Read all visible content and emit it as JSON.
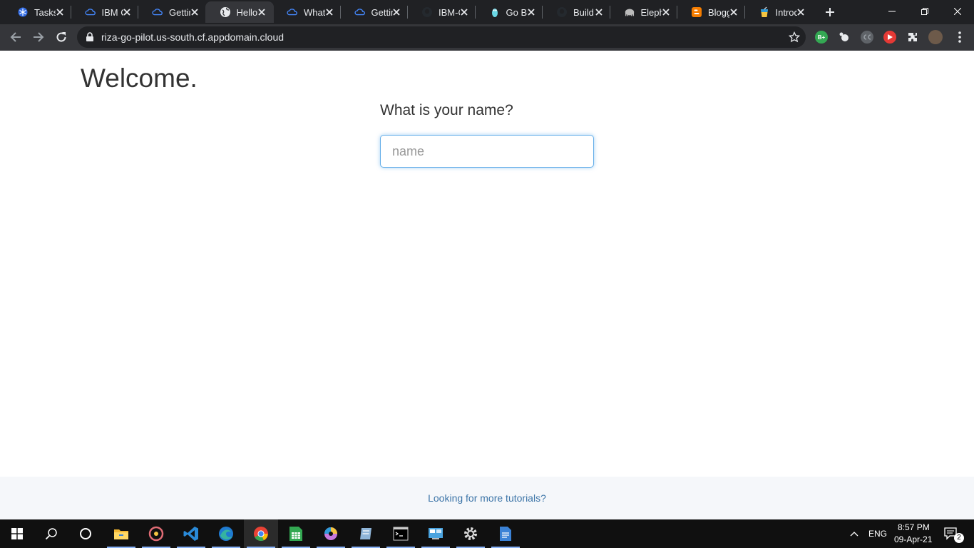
{
  "browser": {
    "tabs": [
      {
        "title": "Tasks",
        "icon": "kubernetes-icon",
        "active": false
      },
      {
        "title": "IBM C",
        "icon": "ibm-cloud-icon",
        "active": false
      },
      {
        "title": "Gettin",
        "icon": "ibm-cloud-icon",
        "active": false
      },
      {
        "title": "Hello",
        "icon": "globe-icon",
        "active": true
      },
      {
        "title": "What",
        "icon": "ibm-cloud-icon",
        "active": false
      },
      {
        "title": "Gettin",
        "icon": "ibm-cloud-icon",
        "active": false
      },
      {
        "title": "IBM-C",
        "icon": "github-icon",
        "active": false
      },
      {
        "title": "Go Bu",
        "icon": "gopher-icon",
        "active": false
      },
      {
        "title": "Build",
        "icon": "github-icon",
        "active": false
      },
      {
        "title": "Eleph",
        "icon": "elephant-icon",
        "active": false
      },
      {
        "title": "Blogg",
        "icon": "blogger-icon",
        "active": false
      },
      {
        "title": "Introd",
        "icon": "drink-icon",
        "active": false
      }
    ],
    "url": "riza-go-pilot.us-south.cf.appdomain.cloud",
    "extensions": [
      {
        "name": "bplus-extension-icon",
        "label": "B+",
        "color": "#34a853"
      },
      {
        "name": "bubbles-extension-icon",
        "label": "",
        "color": "#35363a"
      },
      {
        "name": "cc-extension-icon",
        "label": "",
        "color": "#5f6368"
      },
      {
        "name": "youtube-extension-icon",
        "label": "",
        "color": "#e53935"
      }
    ]
  },
  "page": {
    "heading": "Welcome.",
    "question": "What is your name?",
    "input_placeholder": "name",
    "input_value": "",
    "footer_link": "Looking for more tutorials?"
  },
  "taskbar": {
    "apps": [
      {
        "name": "file-explorer-icon",
        "color": "#f2b632",
        "active": false
      },
      {
        "name": "media-player-icon",
        "color": "#e06c75",
        "active": false
      },
      {
        "name": "vscode-icon",
        "color": "#2a8ad8",
        "active": false
      },
      {
        "name": "edge-icon",
        "color": "#35b3a0",
        "active": false
      },
      {
        "name": "chrome-icon",
        "color": "#e94235",
        "active": true
      },
      {
        "name": "spreadsheet-icon",
        "color": "#33a852",
        "active": false
      },
      {
        "name": "color-wheel-icon",
        "color": "#c678dd",
        "active": false
      },
      {
        "name": "notebook-icon",
        "color": "#8fb5d8",
        "active": false
      },
      {
        "name": "terminal-icon",
        "color": "#cccccc",
        "active": false
      },
      {
        "name": "control-panel-icon",
        "color": "#4aa3df",
        "active": false
      },
      {
        "name": "settings-gear-icon",
        "color": "#dddddd",
        "active": false
      },
      {
        "name": "document-icon",
        "color": "#3b82d6",
        "active": false
      }
    ],
    "language": "ENG",
    "time": "8:57 PM",
    "date": "09-Apr-21",
    "notification_count": "2"
  }
}
